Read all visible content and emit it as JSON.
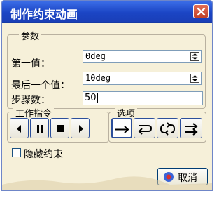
{
  "window": {
    "title": "制作约束动画",
    "close_icon": "close-icon"
  },
  "params": {
    "group_title": "参数",
    "first_value_label": "第一值：",
    "first_value": "0deg",
    "last_value_label": "最后一个值：",
    "last_value": "10deg",
    "steps_label": "步骤数：",
    "steps_value": "50"
  },
  "commands": {
    "group_title": "工作指令",
    "buttons": [
      "step-back",
      "pause",
      "stop",
      "step-forward"
    ]
  },
  "options": {
    "group_title": "选项",
    "buttons": [
      "one-shot",
      "reverse",
      "loop",
      "repeat"
    ],
    "selected": "one-shot"
  },
  "hide_constraints": {
    "label": "隐藏约束",
    "checked": false
  },
  "cancel": {
    "label": "取消",
    "icon": "cancel-icon"
  },
  "colors": {
    "title_bar": "#1b45c5",
    "background": "#f6f0d9",
    "close": "#c24229",
    "button_border": "#2c4f9b"
  }
}
